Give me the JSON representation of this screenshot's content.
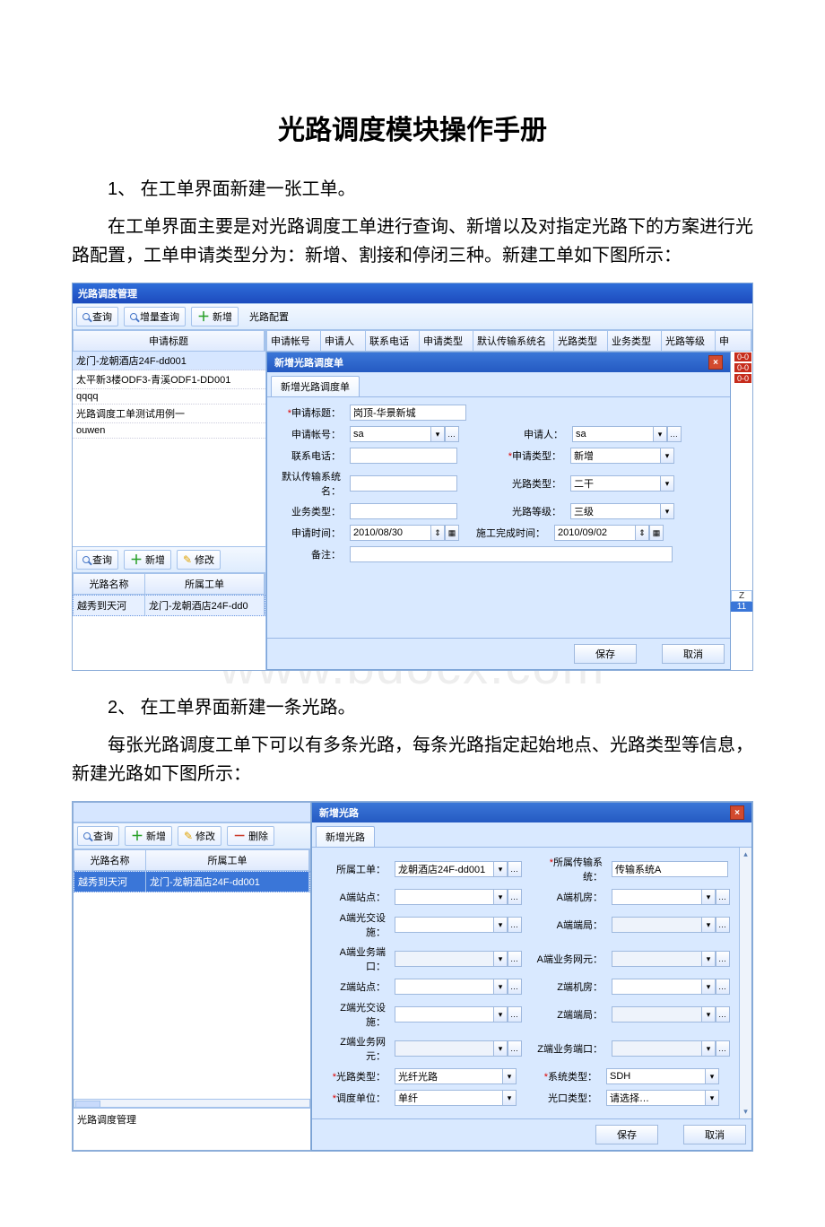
{
  "doc": {
    "title": "光路调度模块操作手册",
    "step1": "1、 在工单界面新建一张工单。",
    "para1": "在工单界面主要是对光路调度工单进行查询、新增以及对指定光路下的方案进行光路配置，工单申请类型分为：新增、割接和停闭三种。新建工单如下图所示：",
    "step2": "2、 在工单界面新建一条光路。",
    "para2": "每张光路调度工单下可以有多条光路，每条光路指定起始地点、光路类型等信息，新建光路如下图所示：",
    "watermark": "www.bdocx.com"
  },
  "shot1": {
    "win_title": "光路调度管理",
    "toolbar": {
      "search": "查询",
      "inc_search": "增量查询",
      "add": "新增",
      "cfg": "光路配置"
    },
    "columns": [
      "申请标题",
      "申请帐号",
      "申请人",
      "联系电话",
      "申请类型",
      "默认传输系统名",
      "光路类型",
      "业务类型",
      "光路等级",
      "申"
    ],
    "rows": [
      "龙门-龙朝酒店24F-dd001",
      "太平新3楼ODF3-青溪ODF1-DD001",
      "qqqq",
      "光路调度工单测试用例一",
      "ouwen"
    ],
    "right_badges": [
      "0-0",
      "0-0",
      "0-0"
    ],
    "sub_toolbar": {
      "search": "查询",
      "add": "新增",
      "edit": "修改"
    },
    "sub_columns": [
      "光路名称",
      "所属工单"
    ],
    "sub_row": [
      "越秀到天河",
      "龙门-龙朝酒店24F-dd0"
    ],
    "right_tail": [
      "Z",
      "11"
    ],
    "dialog": {
      "title": "新增光路调度单",
      "tab": "新增光路调度单",
      "labels": {
        "topic": "申请标题：",
        "acct": "申请帐号：",
        "person": "申请人：",
        "phone": "联系电话：",
        "reqtype": "申请类型：",
        "sysname": "默认传输系统名：",
        "ltype": "光路类型：",
        "biz": "业务类型：",
        "level": "光路等级：",
        "atime": "申请时间：",
        "ctime": "施工完成时间：",
        "note": "备注："
      },
      "values": {
        "topic": "岗顶-华景新城",
        "acct": "sa",
        "person": "sa",
        "reqtype": "新增",
        "ltype": "二干",
        "level": "三级",
        "atime": "2010/08/30",
        "ctime": "2010/09/02"
      },
      "btn_save": "保存",
      "btn_cancel": "取消"
    }
  },
  "shot2": {
    "left_toolbar": {
      "search": "查询",
      "add": "新增",
      "edit": "修改",
      "del": "删除"
    },
    "left_columns": [
      "光路名称",
      "所属工单"
    ],
    "left_row": [
      "越秀到天河",
      "龙门-龙朝酒店24F-dd001"
    ],
    "footer": "光路调度管理",
    "dialog": {
      "title": "新增光路",
      "tab": "新增光路",
      "labels": {
        "order": "所属工单：",
        "sys": "所属传输系统：",
        "asite": "A端站点：",
        "aroom": "A端机房：",
        "aodf": "A端光交设施：",
        "aend": "A端端局：",
        "aport": "A端业务端口：",
        "ane": "A端业务网元：",
        "zsite": "Z端站点：",
        "zroom": "Z端机房：",
        "zodf": "Z端光交设施：",
        "zend": "Z端端局：",
        "zne": "Z端业务网元：",
        "zport": "Z端业务端口：",
        "ltype": "光路类型：",
        "stype": "系统类型：",
        "dunit": "调度单位：",
        "otype": "光口类型："
      },
      "values": {
        "order": "龙朝酒店24F-dd001",
        "sys": "传输系统A",
        "ltype": "光纤光路",
        "stype": "SDH",
        "dunit": "单纤",
        "otype": "请选择…"
      },
      "btn_save": "保存",
      "btn_cancel": "取消"
    }
  }
}
